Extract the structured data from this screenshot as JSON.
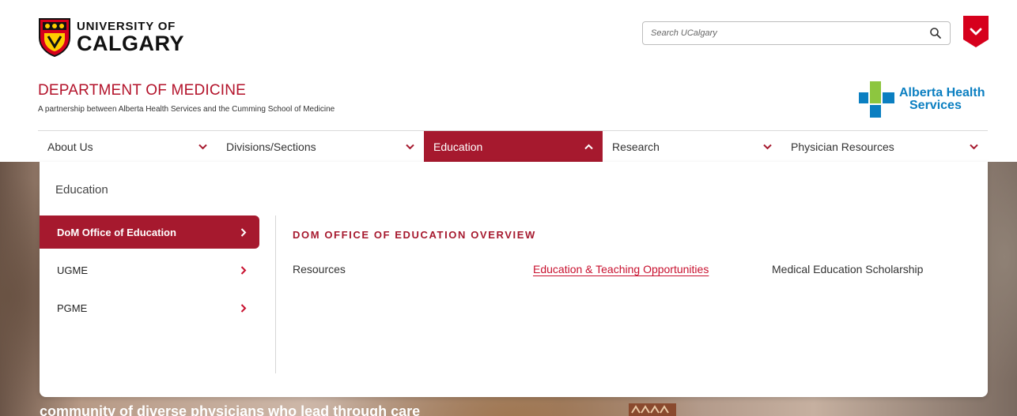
{
  "header": {
    "logo": {
      "line1": "UNIVERSITY OF",
      "line2": "CALGARY"
    },
    "search": {
      "placeholder": "Search UCalgary",
      "icon": "search-icon"
    },
    "quicklinks_icon": "chevron-down-icon"
  },
  "department": {
    "title": "DEPARTMENT OF MEDICINE",
    "subtitle": "A partnership between Alberta Health Services and the Cumming School of Medicine"
  },
  "partner_logo": {
    "line1": "Alberta Health",
    "line2": "Services"
  },
  "nav": {
    "items": [
      {
        "label": "About Us",
        "expanded": false
      },
      {
        "label": "Divisions/Sections",
        "expanded": false
      },
      {
        "label": "Education",
        "expanded": true
      },
      {
        "label": "Research",
        "expanded": false
      },
      {
        "label": "Physician Resources",
        "expanded": false
      }
    ]
  },
  "mega_menu": {
    "title": "Education",
    "side_items": [
      {
        "label": "DoM Office of Education",
        "active": true
      },
      {
        "label": "UGME",
        "active": false
      },
      {
        "label": "PGME",
        "active": false
      }
    ],
    "overview_heading": "DOM OFFICE OF EDUCATION OVERVIEW",
    "links": [
      {
        "label": "Resources"
      },
      {
        "label": "Education & Teaching Opportunities",
        "hovered": true
      },
      {
        "label": "Medical Education Scholarship"
      }
    ]
  },
  "hero": {
    "text": "community of diverse physicians who lead through care"
  },
  "colors": {
    "brand_red": "#a6192e",
    "link_red": "#c8102e",
    "ahs_blue": "#0b7fc1",
    "ahs_green": "#8dc63f"
  }
}
